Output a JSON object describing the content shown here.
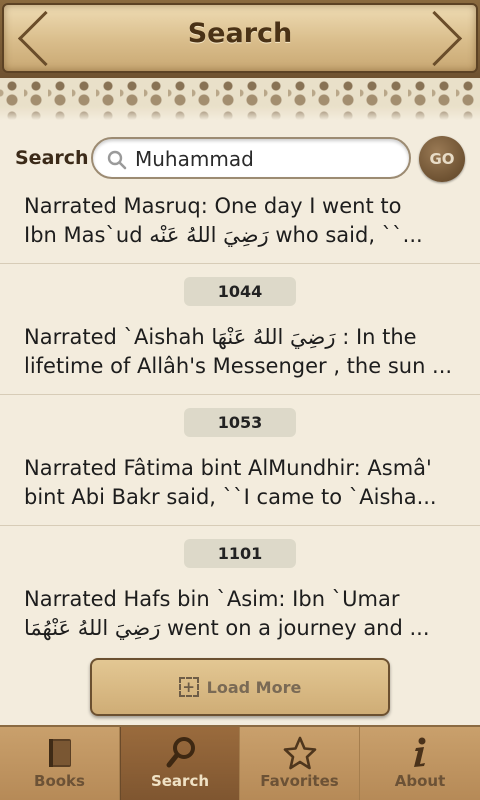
{
  "header": {
    "title": "Search"
  },
  "search": {
    "label": "Search",
    "value": "Muhammad",
    "go_label": "GO"
  },
  "results": [
    {
      "line1": "Narrated Masruq: One day I went to",
      "line2": "Ibn Mas`ud رَضِيَ اللهُ عَنْه who said, ``..."
    },
    {
      "ref": "1044",
      "line1": "Narrated `Aishah رَضِيَ اللهُ عَنْهَا : In the",
      "line2": "lifetime of Allâh's Messenger , the sun ..."
    },
    {
      "ref": "1053",
      "line1": "Narrated Fâtima bint AlMundhir: Asmâ'",
      "line2": "bint Abi Bakr said, ``I came to `Aisha..."
    },
    {
      "ref": "1101",
      "line1": "Narrated Hafs bin `Asim: Ibn `Umar",
      "line2": "رَضِيَ اللهُ عَنْهُمَا went on a journey and ..."
    }
  ],
  "load_more": {
    "label": "Load More"
  },
  "tabs": [
    {
      "label": "Books",
      "icon": "book-icon"
    },
    {
      "label": "Search",
      "icon": "search-icon",
      "active": true
    },
    {
      "label": "Favorites",
      "icon": "star-icon"
    },
    {
      "label": "About",
      "icon": "info-icon"
    }
  ],
  "colors": {
    "background": "#f3ecdd",
    "header_text": "#4a3216",
    "tab_active": "#8b5f35",
    "badge": "#ddd9c9"
  }
}
